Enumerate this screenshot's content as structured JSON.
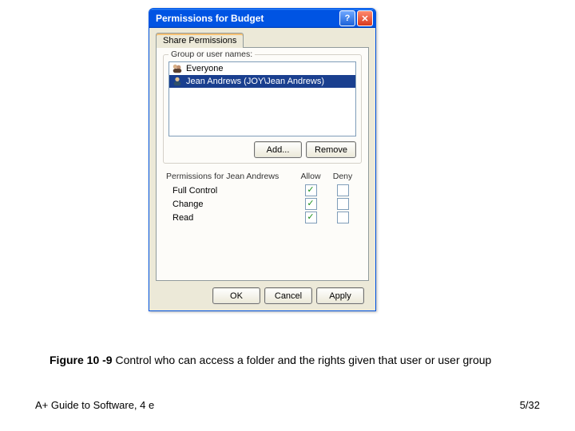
{
  "window": {
    "title": "Permissions for Budget",
    "help_label": "?",
    "close_label": "✕"
  },
  "tab": {
    "label": "Share Permissions"
  },
  "group_users": {
    "legend": "Group or user names:",
    "items": [
      {
        "label": "Everyone",
        "selected": false
      },
      {
        "label": "Jean Andrews (JOY\\Jean Andrews)",
        "selected": true
      }
    ]
  },
  "buttons": {
    "add": "Add...",
    "remove": "Remove",
    "ok": "OK",
    "cancel": "Cancel",
    "apply": "Apply"
  },
  "perms": {
    "header_label": "Permissions for Jean Andrews",
    "col_allow": "Allow",
    "col_deny": "Deny",
    "rows": [
      {
        "name": "Full Control",
        "allow": true,
        "deny": false
      },
      {
        "name": "Change",
        "allow": true,
        "deny": false
      },
      {
        "name": "Read",
        "allow": true,
        "deny": false
      }
    ]
  },
  "caption": {
    "figno": "Figure 10 -9",
    "text": " Control who can access a folder and the rights given that user or user group"
  },
  "footer": {
    "left": "A+ Guide to Software, 4 e",
    "right": "5/32"
  }
}
